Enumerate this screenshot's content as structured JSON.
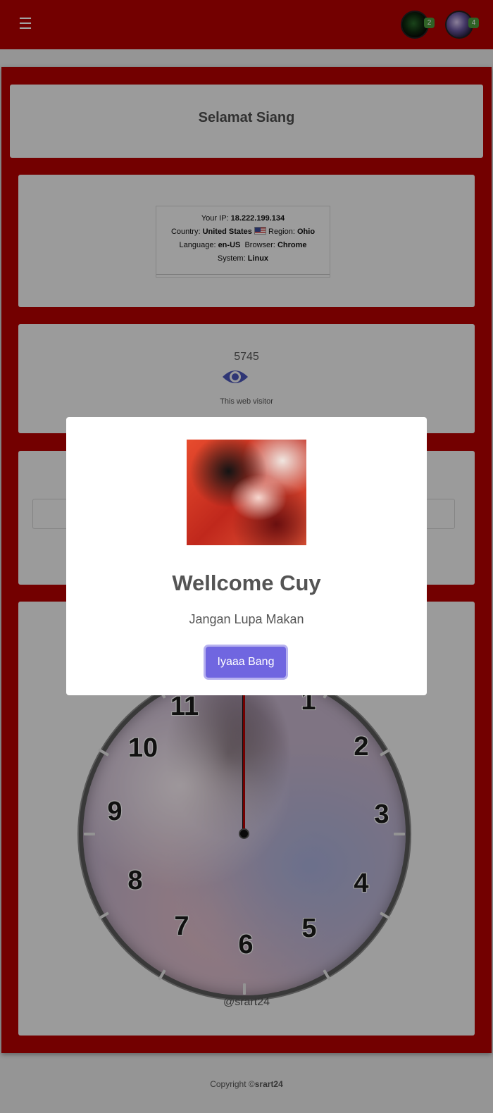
{
  "navbar": {
    "menu_icon": "hamburger-icon",
    "notifications": [
      {
        "avatar": "avatar-icon",
        "badge": "2"
      },
      {
        "avatar": "avatar-icon",
        "badge": "4"
      }
    ]
  },
  "greeting": {
    "title": "Selamat Siang"
  },
  "ip_info": {
    "ip_label": "Your IP:",
    "ip_value": "18.222.199.134",
    "country_label": "Country:",
    "country_value": "United States",
    "region_label": "Region:",
    "region_value": "Ohio",
    "language_label": "Language:",
    "language_value": "en-US",
    "browser_label": "Browser:",
    "browser_value": "Chrome",
    "system_label": "System:",
    "system_value": "Linux"
  },
  "visitor": {
    "count": "5745",
    "label": "This web visitor",
    "icon": "eye-icon"
  },
  "search": {
    "placeholder": ""
  },
  "clock": {
    "numbers": [
      "1",
      "2",
      "3",
      "4",
      "5",
      "6",
      "7",
      "8",
      "9",
      "10",
      "11"
    ],
    "signature": "@srart24"
  },
  "footer": {
    "prefix": "Copyright ©",
    "owner": "srart24"
  },
  "modal": {
    "image": "profile-illustration",
    "title": "Wellcome Cuy",
    "text": "Jangan Lupa Makan",
    "button": "Iyaaa Bang"
  },
  "colors": {
    "primary": "#b50000",
    "accent": "#7066e0",
    "eye": "#4a55b8"
  }
}
